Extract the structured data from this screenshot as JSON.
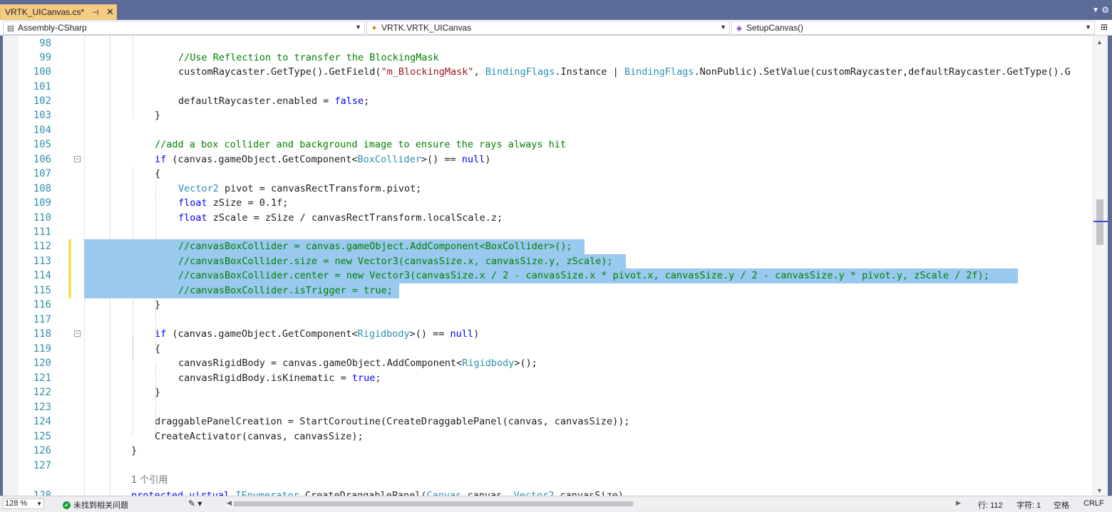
{
  "tab": {
    "title": "VRTK_UICanvas.cs*",
    "pin": "⊣",
    "close": "✕"
  },
  "nav": {
    "project": "Assembly-CSharp",
    "class": "VRTK.VRTK_UICanvas",
    "member": "SetupCanvas()"
  },
  "lines": [
    {
      "n": "98",
      "code": []
    },
    {
      "n": "99",
      "code": [
        [
          "cm",
          "//Use Reflection to transfer the BlockingMask"
        ]
      ]
    },
    {
      "n": "100",
      "code": [
        [
          "",
          "customRaycaster.GetType().GetField("
        ],
        [
          "st",
          "\"m_BlockingMask\""
        ],
        [
          "",
          ", "
        ],
        [
          "ty",
          "BindingFlags"
        ],
        [
          "",
          ".Instance | "
        ],
        [
          "ty",
          "BindingFlags"
        ],
        [
          "",
          ".NonPublic).SetValue(customRaycaster,defaultRaycaster.GetType().G"
        ]
      ]
    },
    {
      "n": "101",
      "code": []
    },
    {
      "n": "102",
      "code": [
        [
          "",
          "defaultRaycaster.enabled = "
        ],
        [
          "kw",
          "false"
        ],
        [
          "",
          ";"
        ]
      ]
    },
    {
      "n": "103",
      "code": [
        [
          "",
          "}"
        ]
      ]
    },
    {
      "n": "104",
      "code": []
    },
    {
      "n": "105",
      "code": [
        [
          "cm",
          "//add a box collider and background image to ensure the rays always hit"
        ]
      ]
    },
    {
      "n": "106",
      "code": [
        [
          "kw",
          "if"
        ],
        [
          "",
          " (canvas.gameObject.GetComponent<"
        ],
        [
          "ty",
          "BoxCollider"
        ],
        [
          "",
          ">() == "
        ],
        [
          "kw",
          "null"
        ],
        [
          "",
          ")"
        ]
      ]
    },
    {
      "n": "107",
      "code": [
        [
          "",
          "{"
        ]
      ]
    },
    {
      "n": "108",
      "code": [
        [
          "ty",
          "Vector2"
        ],
        [
          "",
          " pivot = canvasRectTransform.pivot;"
        ]
      ]
    },
    {
      "n": "109",
      "code": [
        [
          "kw",
          "float"
        ],
        [
          "",
          " zSize = 0.1f;"
        ]
      ]
    },
    {
      "n": "110",
      "code": [
        [
          "kw",
          "float"
        ],
        [
          "",
          " zScale = zSize / canvasRectTransform.localScale.z;"
        ]
      ]
    },
    {
      "n": "111",
      "code": []
    },
    {
      "n": "112",
      "code": [
        [
          "cm",
          "//canvasBoxCollider = canvas.gameObject.AddComponent<BoxCollider>();"
        ]
      ]
    },
    {
      "n": "113",
      "code": [
        [
          "cm",
          "//canvasBoxCollider.size = new Vector3(canvasSize.x, canvasSize.y, zScale);"
        ]
      ]
    },
    {
      "n": "114",
      "code": [
        [
          "cm",
          "//canvasBoxCollider.center = new Vector3(canvasSize.x / 2 - canvasSize.x * pivot.x, canvasSize.y / 2 - canvasSize.y * pivot.y, zScale / 2f);"
        ]
      ]
    },
    {
      "n": "115",
      "code": [
        [
          "cm",
          "//canvasBoxCollider.isTrigger = true;"
        ]
      ]
    },
    {
      "n": "116",
      "code": [
        [
          "",
          "}"
        ]
      ]
    },
    {
      "n": "117",
      "code": []
    },
    {
      "n": "118",
      "code": [
        [
          "kw",
          "if"
        ],
        [
          "",
          " (canvas.gameObject.GetComponent<"
        ],
        [
          "ty",
          "Rigidbody"
        ],
        [
          "",
          ">() == "
        ],
        [
          "kw",
          "null"
        ],
        [
          "",
          ")"
        ]
      ]
    },
    {
      "n": "119",
      "code": [
        [
          "",
          "{"
        ]
      ]
    },
    {
      "n": "120",
      "code": [
        [
          "",
          "canvasRigidBody = canvas.gameObject.AddComponent<"
        ],
        [
          "ty",
          "Rigidbody"
        ],
        [
          "",
          ">();"
        ]
      ]
    },
    {
      "n": "121",
      "code": [
        [
          "",
          "canvasRigidBody.isKinematic = "
        ],
        [
          "kw",
          "true"
        ],
        [
          "",
          ";"
        ]
      ]
    },
    {
      "n": "122",
      "code": [
        [
          "",
          "}"
        ]
      ]
    },
    {
      "n": "123",
      "code": []
    },
    {
      "n": "124",
      "code": [
        [
          "",
          "draggablePanelCreation = StartCoroutine(CreateDraggablePanel(canvas, canvasSize));"
        ]
      ]
    },
    {
      "n": "125",
      "code": [
        [
          "",
          "CreateActivator(canvas, canvasSize);"
        ]
      ]
    },
    {
      "n": "126",
      "code": [
        [
          "",
          "}"
        ]
      ]
    },
    {
      "n": "127",
      "code": []
    },
    {
      "n": "",
      "code": [
        [
          "ref",
          "1 个引用"
        ]
      ]
    },
    {
      "n": "128",
      "code": [
        [
          "kw",
          "protected virtual "
        ],
        [
          "ty",
          "IEnumerator"
        ],
        [
          "",
          " CreateDraggablePanel("
        ],
        [
          "ty",
          "Canvas"
        ],
        [
          "",
          " canvas, "
        ],
        [
          "ty",
          "Vector2"
        ],
        [
          "",
          " canvasSize)"
        ]
      ]
    }
  ],
  "status": {
    "zoom": "128 %",
    "issues": "未找到相关问题",
    "line": "行: 112",
    "char": "字符: 1",
    "whitespace": "空格",
    "eol": "CRLF"
  }
}
